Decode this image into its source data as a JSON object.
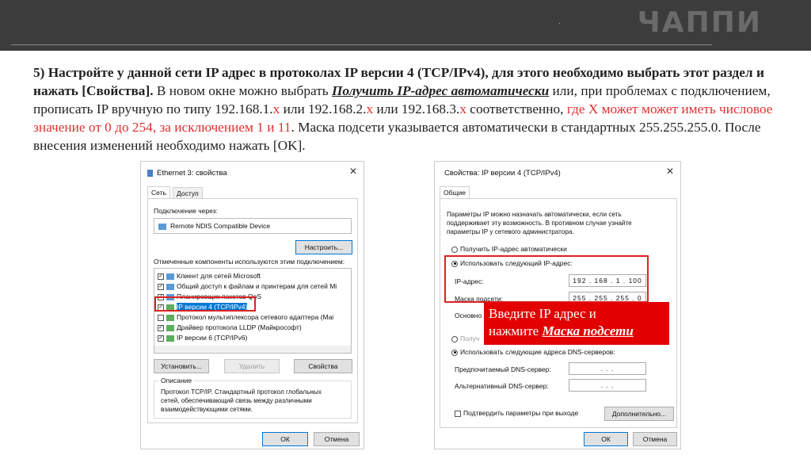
{
  "header": {
    "logo": "ЧАППИ",
    "dot": "."
  },
  "instruction": {
    "p1_bold": "5) Настройте у данной сети IP адрес в протоколах IP версии 4 (TCP/IPv4), для этого необходимо выбрать этот раздел и нажать [Свойства].",
    "p2": " В новом окне можно выбрать ",
    "p3_bi": "Получить IP-адрес автоматически",
    "p4": " или, при проблемах с подключением, прописать IP вручную по типу 192.168.1.",
    "x1": "x",
    "p5": " или 192.168.2.",
    "x2": "x",
    "p6": " или 192.168.3.",
    "x3": "x",
    "p7": " соответственно, ",
    "p8_red": "где Х может может иметь числовое значение от 0 до 254, за исключением 1 и 11",
    "p9": ". Маска подсети указывается автоматически в стандартных 255.255.255.0. После внесения изменений необходимо нажать [OK]."
  },
  "dialog1": {
    "title": "Ethernet 3: свойства",
    "close": "✕",
    "tabs": [
      "Сеть",
      "Доступ"
    ],
    "connect_via_label": "Подключение через:",
    "device": "Remote NDIS Compatible Device",
    "configure_button": "Настроить...",
    "components_label": "Отмеченные компоненты используются этим подключением:",
    "components": [
      {
        "label": "Клиент для сетей Microsoft",
        "checked": true
      },
      {
        "label": "Общий доступ к файлам и принтерам для сетей Mi",
        "checked": true
      },
      {
        "label": "Планировщик пакетов QoS",
        "checked": true
      },
      {
        "label": "IP версии 4 (TCP/IPv4)",
        "checked": true,
        "selected": true
      },
      {
        "label": "Протокол мультиплексора сетевого адаптера (Mai",
        "checked": false
      },
      {
        "label": "Драйвер протокола LLDP (Майкрософт)",
        "checked": true
      },
      {
        "label": "IP версии 6 (TCP/IPv6)",
        "checked": true
      }
    ],
    "install_button": "Установить...",
    "remove_button": "Удалить",
    "properties_button": "Свойства",
    "description_title": "Описание",
    "description": "Протокол TCP/IP. Стандартный протокол глобальных сетей, обеспечивающий связь между различными взаимодействующими сетями.",
    "ok": "ОК",
    "cancel": "Отмена"
  },
  "dialog2": {
    "title": "Свойства: IP версии 4 (TCP/IPv4)",
    "close": "✕",
    "tab": "Общие",
    "intro": "Параметры IP можно назначать автоматически, если сеть поддерживает эту возможность. В противном случае узнайте параметры IP у сетевого администратора.",
    "auto_ip": "Получить IP-адрес автоматически",
    "manual_ip": "Использовать следующий IP-адрес:",
    "ip_label": "IP-адрес:",
    "ip_value": "192 . 168 . 1 . 100",
    "mask_label": "Маска подсети:",
    "mask_value": "255 . 255 . 255 . 0",
    "gateway_label": "Основно",
    "auto_dns_partial": "Получ",
    "manual_dns": "Использовать следующие адреса DNS-серверов:",
    "pref_dns_label": "Предпочитаемый DNS-сервер:",
    "alt_dns_label": "Альтернативный DNS-сервер:",
    "empty_ip": ".      .      .",
    "validate": "Подтвердить параметры при выходе",
    "advanced_button": "Дополнительно...",
    "ok": "ОК",
    "cancel": "Отмена"
  },
  "callout": {
    "line1": "Введите IP адрес и",
    "line2a": "нажмите ",
    "line2b": "Маска подсети"
  }
}
